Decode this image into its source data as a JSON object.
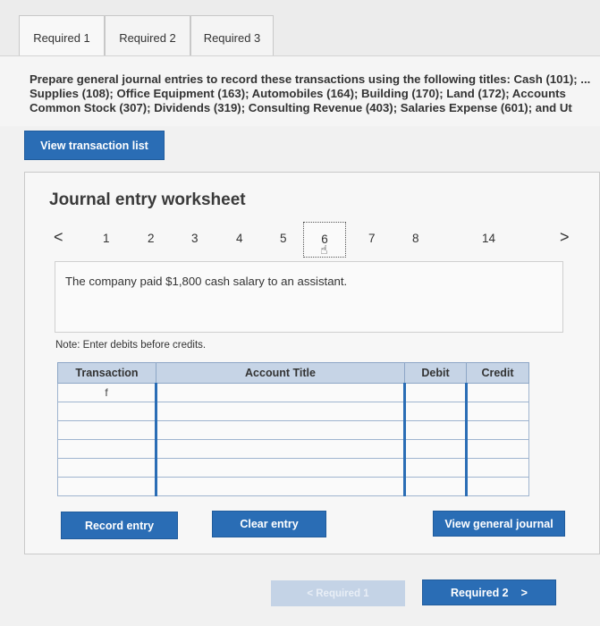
{
  "tabs": [
    {
      "label": "Required 1"
    },
    {
      "label": "Required 2"
    },
    {
      "label": "Required 3"
    }
  ],
  "instructions": {
    "line1": "Prepare general journal entries to record these transactions using the following titles: Cash (101); ...",
    "line2": "Supplies (108); Office Equipment (163); Automobiles (164); Building (170); Land (172); Accounts",
    "line3": "Common Stock (307); Dividends (319); Consulting Revenue (403); Salaries Expense (601); and Ut"
  },
  "view_transaction_list": "View transaction list",
  "worksheet": {
    "title": "Journal entry worksheet",
    "pager": {
      "prev": "<",
      "next": ">",
      "pages": [
        "1",
        "2",
        "3",
        "4",
        "5",
        "6",
        "7",
        "8",
        "14"
      ],
      "current": "6"
    },
    "description": "The company paid $1,800 cash salary to an assistant.",
    "note": "Note: Enter debits before credits.",
    "table": {
      "headers": [
        "Transaction",
        "Account Title",
        "Debit",
        "Credit"
      ],
      "rows": [
        {
          "transaction": "f"
        },
        {
          "transaction": ""
        },
        {
          "transaction": ""
        },
        {
          "transaction": ""
        },
        {
          "transaction": ""
        },
        {
          "transaction": ""
        }
      ]
    },
    "buttons": {
      "record": "Record entry",
      "clear": "Clear entry",
      "view_journal": "View general journal"
    }
  },
  "footer": {
    "prev_label": "< Required 1",
    "next_label": "Required 2",
    "next_chevron": ">"
  }
}
